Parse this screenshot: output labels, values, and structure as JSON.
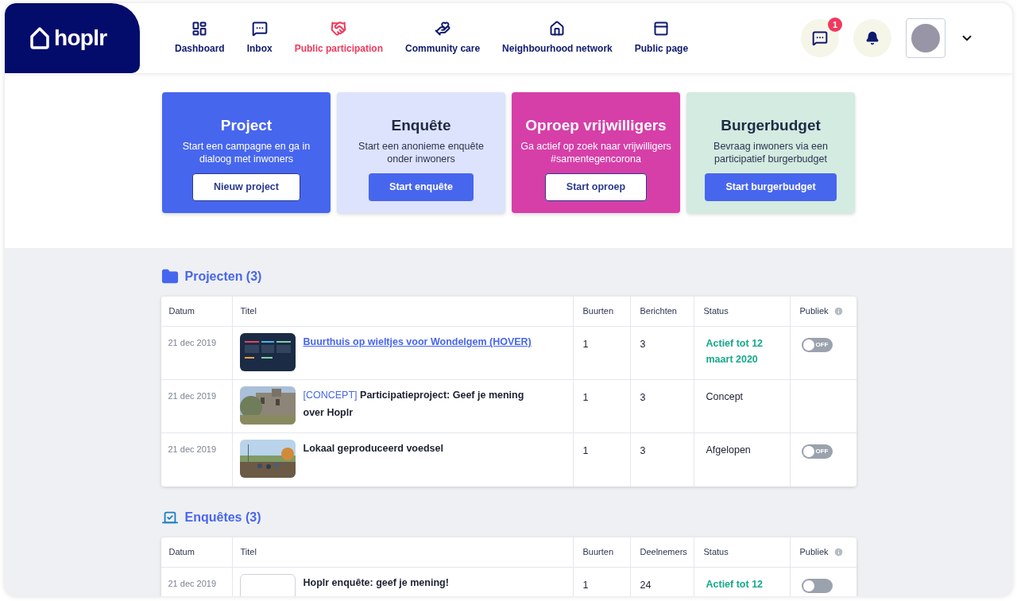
{
  "logo": {
    "text": "hoplr"
  },
  "nav": [
    {
      "label": "Dashboard",
      "selected": false
    },
    {
      "label": "Inbox",
      "selected": false
    },
    {
      "label": "Public participation",
      "selected": true
    },
    {
      "label": "Community care",
      "selected": false
    },
    {
      "label": "Neighbourhood network",
      "selected": false
    },
    {
      "label": "Public page",
      "selected": false
    }
  ],
  "header_actions": {
    "messages_badge": "1"
  },
  "cards": [
    {
      "title": "Project",
      "text": "Start een campagne en ga in dialoog met inwoners",
      "button": "Nieuw project"
    },
    {
      "title": "Enquête",
      "text": "Start een anonieme enquête onder inwoners",
      "button": "Start enquête"
    },
    {
      "title": "Oproep vrijwilligers",
      "text": "Ga actief op zoek naar vrijwilligers #samentegencorona",
      "button": "Start oproep"
    },
    {
      "title": "Burgerbudget",
      "text": "Bevraag inwoners via een participatief burgerbudget",
      "button": "Start burgerbudget"
    }
  ],
  "sections": [
    {
      "title": "Projecten (3)",
      "columns": [
        "Datum",
        "Titel",
        "Buurten",
        "Berichten",
        "Status",
        "Publiek"
      ],
      "rows": [
        {
          "date": "21 dec 2019",
          "title": "Buurthuis op wieltjes voor Wondelgem (HOVER)",
          "link": true,
          "buurten": "1",
          "count": "3",
          "status": "Actief tot 12 maart 2020",
          "kind": "active",
          "toggle": {
            "on": false,
            "label": "OFF"
          }
        },
        {
          "date": "21 dec 2019",
          "tag": "[CONCEPT]",
          "title": "Participatieproject: Geef je mening over Hoplr",
          "link": false,
          "buurten": "1",
          "count": "3",
          "status": "Concept",
          "kind": "plain"
        },
        {
          "date": "21 dec 2019",
          "title": "Lokaal geproduceerd voedsel",
          "link": false,
          "buurten": "1",
          "count": "3",
          "status": "Afgelopen",
          "kind": "plain",
          "toggle": {
            "on": false,
            "label": "OFF"
          }
        }
      ]
    },
    {
      "title": "Enquêtes (3)",
      "columns": [
        "Datum",
        "Titel",
        "Buurten",
        "Deelnemers",
        "Status",
        "Publiek"
      ],
      "rows": [
        {
          "date": "21 dec 2019",
          "title": "Hoplr enquête: geef je mening!",
          "link": false,
          "buurten": "1",
          "count": "24",
          "status": "Actief tot 12",
          "kind": "active",
          "toggle": {
            "on": false
          }
        }
      ]
    }
  ]
}
